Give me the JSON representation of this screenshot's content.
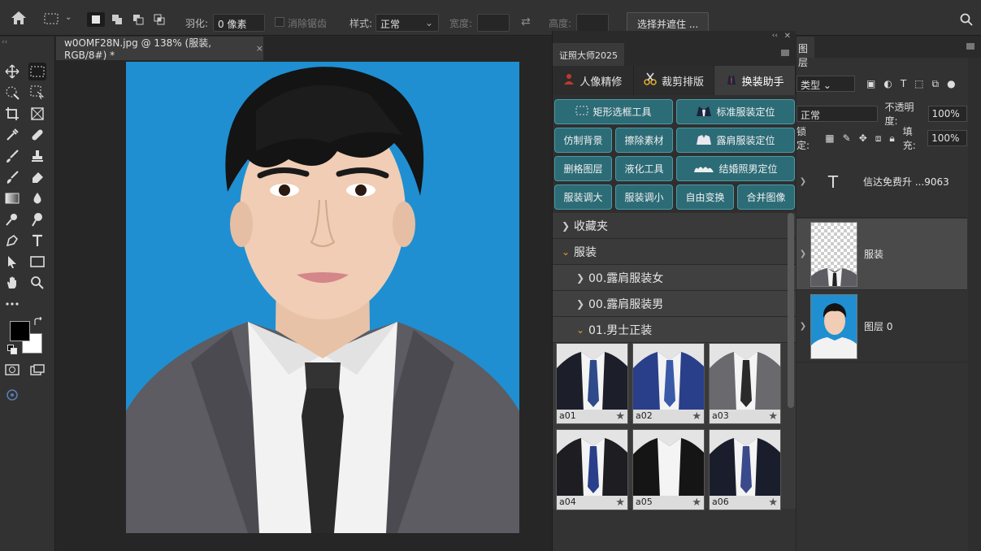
{
  "options_bar": {
    "feather_label": "羽化:",
    "feather_value": "0 像素",
    "antialias_label": "消除锯齿",
    "style_label": "样式:",
    "style_value": "正常",
    "width_label": "宽度:",
    "height_label": "高度:",
    "select_mask_button": "选择并遮住 ..."
  },
  "document": {
    "tab_title": "w0OMF28N.jpg @ 138% (服装, RGB/8#) *",
    "close_glyph": "×"
  },
  "plugin": {
    "title": "证照大师2025",
    "tabs": [
      {
        "label": "人像精修",
        "icon": "portrait-icon"
      },
      {
        "label": "裁剪排版",
        "icon": "scissors-icon"
      },
      {
        "label": "换装助手",
        "icon": "suit-icon"
      }
    ],
    "buttons": [
      {
        "label": "矩形选框工具",
        "icon": "marquee-icon",
        "wide": true
      },
      {
        "label": "标准服装定位",
        "icon": "suit-icon",
        "wide": true
      },
      {
        "label": "仿制背景"
      },
      {
        "label": "擦除素材"
      },
      {
        "label": "露肩服装定位",
        "icon": "shirt-icon",
        "wide": true
      },
      {
        "label": "删格图层"
      },
      {
        "label": "液化工具"
      },
      {
        "label": "结婚照男定位",
        "icon": "wedding-icon",
        "wide": true
      },
      {
        "label": "服装调大"
      },
      {
        "label": "服装调小"
      },
      {
        "label": "自由变换"
      },
      {
        "label": "合并图像"
      }
    ],
    "tree": [
      {
        "label": "收藏夹",
        "level": 0,
        "open": false
      },
      {
        "label": "服装",
        "level": 0,
        "open": true
      },
      {
        "label": "00.露肩服装女",
        "level": 1,
        "open": false
      },
      {
        "label": "00.露肩服装男",
        "level": 1,
        "open": false
      },
      {
        "label": "01.男士正装",
        "level": 1,
        "open": true
      }
    ],
    "thumbnails": [
      {
        "label": "a01",
        "jacket": "#1c1f2a",
        "tie": "#2f4a8a"
      },
      {
        "label": "a02",
        "jacket": "#2a3f8a",
        "tie": "#3a5aa8"
      },
      {
        "label": "a03",
        "jacket": "#6a6a6e",
        "tie": "#2a2a2a"
      },
      {
        "label": "a04",
        "jacket": "#1e1e22",
        "tie": "#2a3f8a"
      },
      {
        "label": "a05",
        "jacket": "#151515",
        "tie": ""
      },
      {
        "label": "a06",
        "jacket": "#1a1e2c",
        "tie": "#3a4a8a"
      }
    ]
  },
  "layers_panel": {
    "tab_label": "图层",
    "filter_value": "类型",
    "blend_value": "正常",
    "opacity_label": "不透明度:",
    "opacity_value": "100%",
    "lock_label": "锁定:",
    "fill_label": "填充:",
    "fill_value": "100%",
    "layers": [
      {
        "name": "信达免费升 ...9063",
        "kind": "text"
      },
      {
        "name": "服装",
        "kind": "smart",
        "selected": true
      },
      {
        "name": "图层 0",
        "kind": "image"
      }
    ]
  },
  "colors": {
    "canvas_background": "#1f8fd2",
    "button_teal": "#2c6c77",
    "accent_orange": "#e0a52b"
  }
}
